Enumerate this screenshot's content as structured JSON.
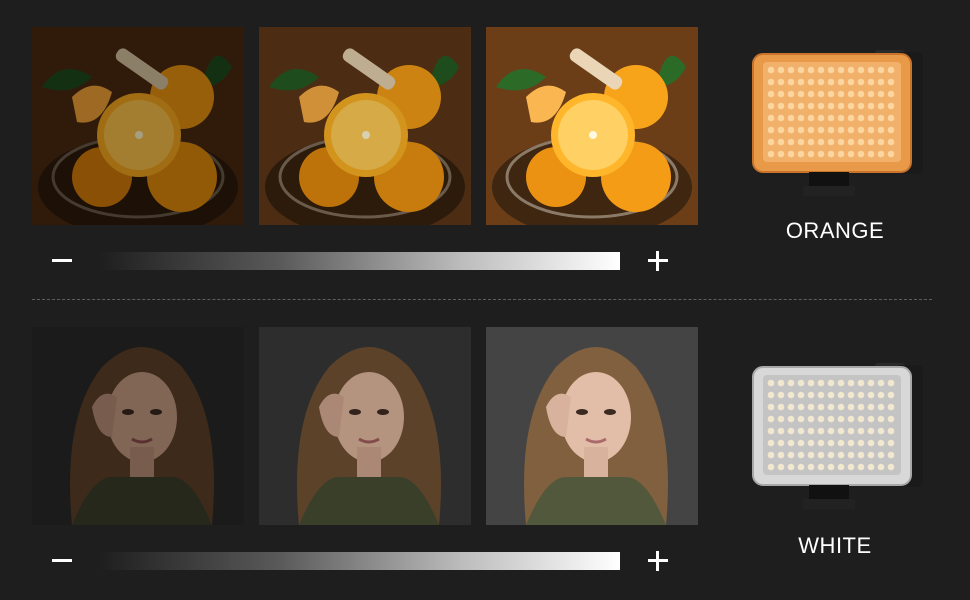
{
  "rows": [
    {
      "subject": "orange-basket",
      "brightness_steps": [
        0.6,
        0.85,
        1.15
      ],
      "light_color": "#f0a04a",
      "label": "ORANGE"
    },
    {
      "subject": "portrait",
      "brightness_steps": [
        0.55,
        0.8,
        1.05
      ],
      "light_color": "#e6e6e6",
      "label": "WHITE"
    }
  ],
  "controls": {
    "decrease_icon": "minus-icon",
    "increase_icon": "plus-icon"
  },
  "colors": {
    "background": "#1e1e1e",
    "divider": "#5e5e5e",
    "text": "#ffffff"
  }
}
